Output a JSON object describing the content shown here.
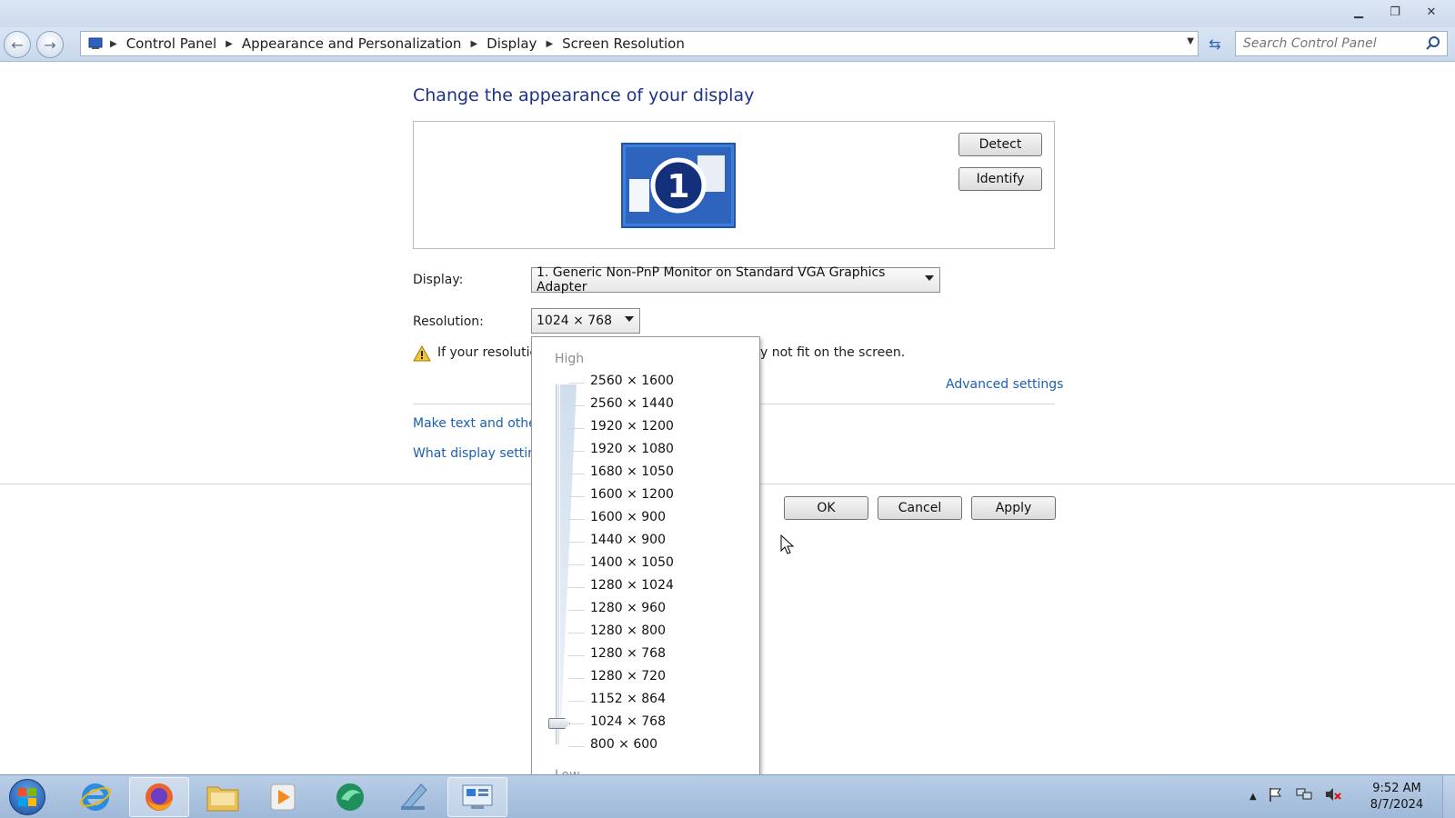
{
  "window": {
    "minimize": "▁",
    "maximize": "❐",
    "close": "✕"
  },
  "address": {
    "breadcrumbs": [
      "Control Panel",
      "Appearance and Personalization",
      "Display",
      "Screen Resolution"
    ],
    "search_placeholder": "Search Control Panel"
  },
  "page": {
    "title": "Change the appearance of your display",
    "monitor_number": "1",
    "detect_label": "Detect",
    "identify_label": "Identify",
    "display_label": "Display:",
    "display_value": "1. Generic Non-PnP Monitor on Standard VGA Graphics Adapter",
    "resolution_label": "Resolution:",
    "resolution_value": "1024 × 768",
    "warning_start": "If your resolutio",
    "warning_end": "y not fit on the screen.",
    "advanced_settings": "Advanced settings",
    "link_text_size": "Make text and other",
    "link_display_settings": "What display setting",
    "ok_label": "OK",
    "cancel_label": "Cancel",
    "apply_label": "Apply"
  },
  "dropdown": {
    "high_label": "High",
    "low_label": "Low",
    "selected_index": 15,
    "options": [
      "2560 × 1600",
      "2560 × 1440",
      "1920 × 1200",
      "1920 × 1080",
      "1680 × 1050",
      "1600 × 1200",
      "1600 × 900",
      "1440 × 900",
      "1400 × 1050",
      "1280 × 1024",
      "1280 × 960",
      "1280 × 800",
      "1280 × 768",
      "1280 × 720",
      "1152 × 864",
      "1024 × 768",
      "800 × 600"
    ]
  },
  "taskbar": {
    "items": [
      "internet-explorer",
      "firefox",
      "file-explorer",
      "media-player",
      "app-green",
      "app-blue",
      "control-panel"
    ],
    "clock_time": "9:52 AM",
    "clock_date": "8/7/2024"
  }
}
